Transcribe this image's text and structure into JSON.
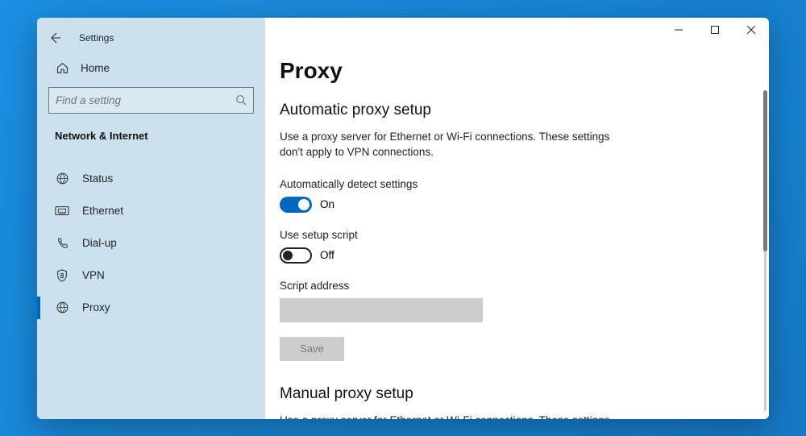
{
  "app": {
    "title": "Settings"
  },
  "sidebar": {
    "home": "Home",
    "search_placeholder": "Find a setting",
    "section": "Network & Internet",
    "items": [
      {
        "label": "Status"
      },
      {
        "label": "Ethernet"
      },
      {
        "label": "Dial-up"
      },
      {
        "label": "VPN"
      },
      {
        "label": "Proxy"
      }
    ]
  },
  "page": {
    "title": "Proxy",
    "auto": {
      "heading": "Automatic proxy setup",
      "description": "Use a proxy server for Ethernet or Wi-Fi connections. These settings don't apply to VPN connections.",
      "autodetect_label": "Automatically detect settings",
      "autodetect_state": "On",
      "usescript_label": "Use setup script",
      "usescript_state": "Off",
      "script_label": "Script address",
      "save_label": "Save"
    },
    "manual": {
      "heading": "Manual proxy setup",
      "description": "Use a proxy server for Ethernet or Wi-Fi connections. These settings"
    }
  },
  "colors": {
    "accent": "#0067c0"
  }
}
